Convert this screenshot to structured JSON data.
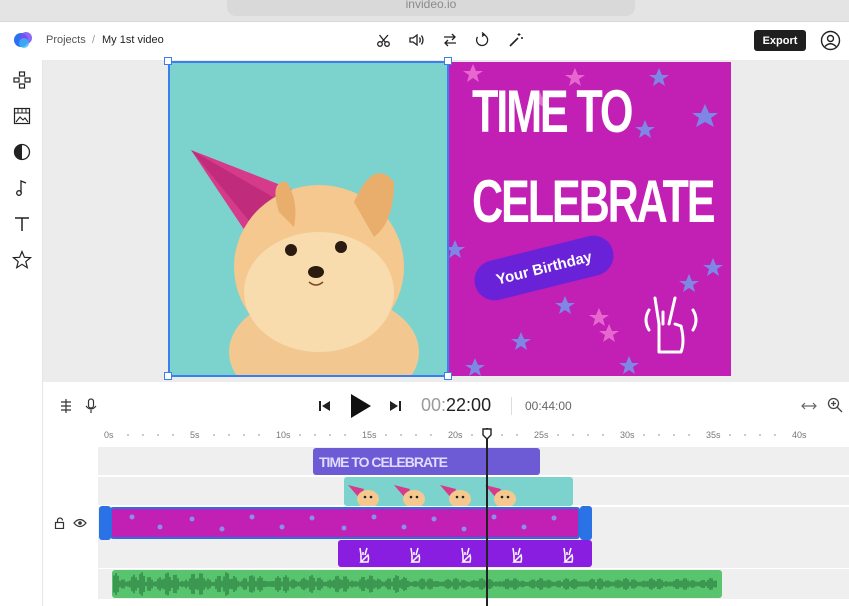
{
  "browser": {
    "url": "invideo.io"
  },
  "header": {
    "breadcrumb_root": "Projects",
    "breadcrumb_sep": "/",
    "breadcrumb_current": "My 1st video",
    "export_label": "Export",
    "tools": [
      "scissors-icon",
      "volume-icon",
      "swap-icon",
      "rotate-icon",
      "magic-wand-icon"
    ]
  },
  "sidebar": {
    "items": [
      "templates-icon",
      "media-icon",
      "stickers-icon",
      "music-icon",
      "text-icon",
      "favorites-icon"
    ]
  },
  "canvas": {
    "headline_line1": "TIME TO",
    "headline_line2": "CELEBRATE",
    "pill_text": "Your Birthday",
    "colors": {
      "photo_bg": "#7cd3cd",
      "poster_bg": "#c21fb4",
      "pill_bg": "#6a22d8",
      "selection": "#3b7ef0"
    }
  },
  "player": {
    "current_time_dim": "00:",
    "current_time": "22:00",
    "total_time": "00:44:00"
  },
  "timeline": {
    "ruler": [
      "0s",
      "5s",
      "10s",
      "15s",
      "20s",
      "25s",
      "30s",
      "35s",
      "40s"
    ],
    "text_clip_label": "TIME TO CELEBRATE",
    "playhead_time_seconds": 22
  }
}
